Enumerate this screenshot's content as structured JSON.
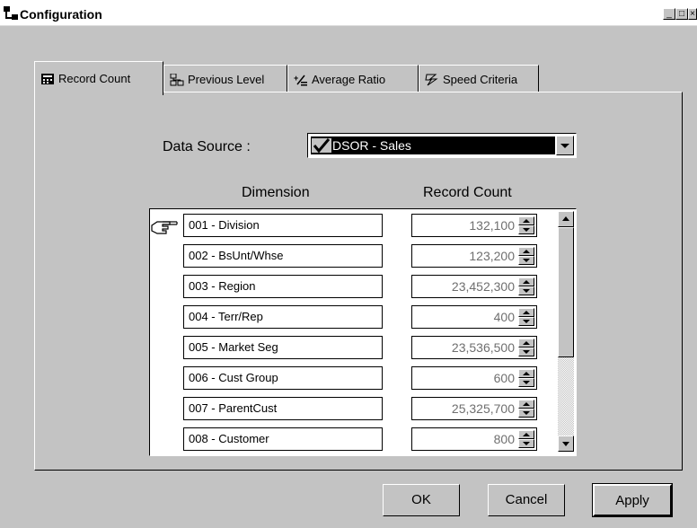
{
  "window": {
    "title": "Configuration"
  },
  "tabs": [
    {
      "label": "Record Count",
      "icon": "calculator-icon",
      "active": true
    },
    {
      "label": "Previous Level",
      "icon": "hierarchy-icon",
      "active": false
    },
    {
      "label": "Average Ratio",
      "icon": "ratio-icon",
      "active": false
    },
    {
      "label": "Speed Criteria",
      "icon": "speed-icon",
      "active": false
    }
  ],
  "data_source": {
    "label": "Data Source :",
    "value": "DSOR - Sales"
  },
  "grid": {
    "col_dimension": "Dimension",
    "col_count": "Record Count",
    "rows": [
      {
        "dimension": "001 - Division",
        "count": "132,100"
      },
      {
        "dimension": "002 - BsUnt/Whse",
        "count": "123,200"
      },
      {
        "dimension": "003 - Region",
        "count": "23,452,300"
      },
      {
        "dimension": "004 - Terr/Rep",
        "count": "400"
      },
      {
        "dimension": "005 - Market Seg",
        "count": "23,536,500"
      },
      {
        "dimension": "006 - Cust Group",
        "count": "600"
      },
      {
        "dimension": "007 - ParentCust",
        "count": "25,325,700"
      },
      {
        "dimension": "008 - Customer",
        "count": "800"
      }
    ]
  },
  "buttons": {
    "ok": "OK",
    "cancel": "Cancel",
    "apply": "Apply"
  }
}
